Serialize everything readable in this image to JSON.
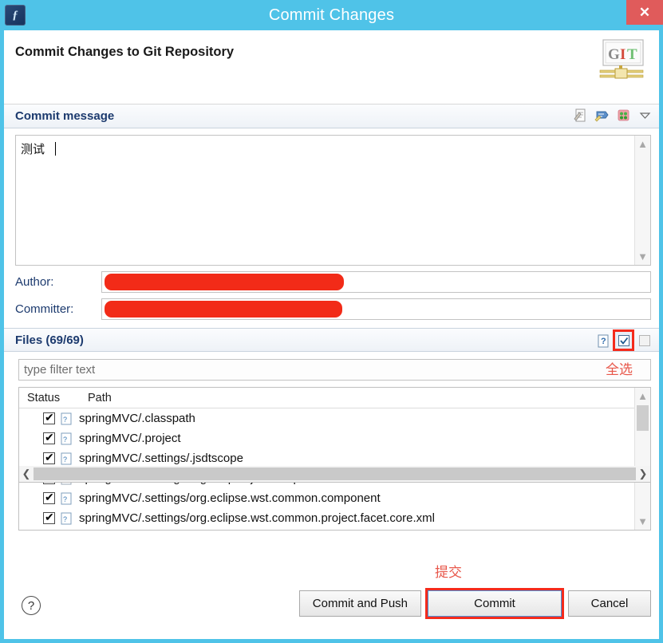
{
  "window": {
    "title": "Commit Changes",
    "app_icon": "eclipse-icon",
    "close_label": "✕",
    "border_color": "#4FC3E8"
  },
  "header": {
    "title": "Commit Changes to Git Repository",
    "logo": {
      "name": "git-logo",
      "g": "G",
      "i": "I",
      "t": "T"
    }
  },
  "commit_message": {
    "section_title": "Commit message",
    "value": "测试",
    "tools": [
      {
        "name": "insert-signed-off-by-icon"
      },
      {
        "name": "insert-change-id-icon"
      },
      {
        "name": "add-gerrit-icon"
      },
      {
        "name": "chevron-down-icon",
        "glyph": "▽"
      }
    ]
  },
  "author": {
    "label": "Author:",
    "value": "",
    "redacted": true
  },
  "committer": {
    "label": "Committer:",
    "value": "",
    "redacted": true
  },
  "files": {
    "section_title": "Files (69/69)",
    "selected_count": 69,
    "total_count": 69,
    "tools": [
      {
        "name": "show-untracked-files-icon",
        "glyph": "?",
        "selected": false
      },
      {
        "name": "select-all-icon",
        "glyph": "✔",
        "selected": true
      },
      {
        "name": "deselect-all-icon",
        "glyph": "",
        "selected": false
      }
    ],
    "filter_placeholder": "type filter text",
    "columns": [
      "Status",
      "Path"
    ],
    "rows": [
      {
        "checked": true,
        "icon": "untracked-file-icon",
        "path": "springMVC/.classpath"
      },
      {
        "checked": true,
        "icon": "untracked-file-icon",
        "path": "springMVC/.project"
      },
      {
        "checked": true,
        "icon": "untracked-file-icon",
        "path": "springMVC/.settings/.jsdtscope"
      },
      {
        "checked": true,
        "icon": "prefs-file-icon",
        "path": "springMVC/.settings/org.eclipse.jdt.core.prefs"
      },
      {
        "checked": true,
        "icon": "untracked-file-icon",
        "path": "springMVC/.settings/org.eclipse.wst.common.component"
      },
      {
        "checked": true,
        "icon": "untracked-file-icon",
        "path": "springMVC/.settings/org.eclipse.wst.common.project.facet.core.xml"
      }
    ]
  },
  "annotations": {
    "select_all": "全选",
    "submit": "提交",
    "color": "#e8574a"
  },
  "footer": {
    "help": "?",
    "buttons": [
      {
        "name": "commit-and-push-button",
        "label": "Commit and Push",
        "primary": false
      },
      {
        "name": "commit-button",
        "label": "Commit",
        "primary": true
      },
      {
        "name": "cancel-button",
        "label": "Cancel",
        "primary": false
      }
    ]
  }
}
